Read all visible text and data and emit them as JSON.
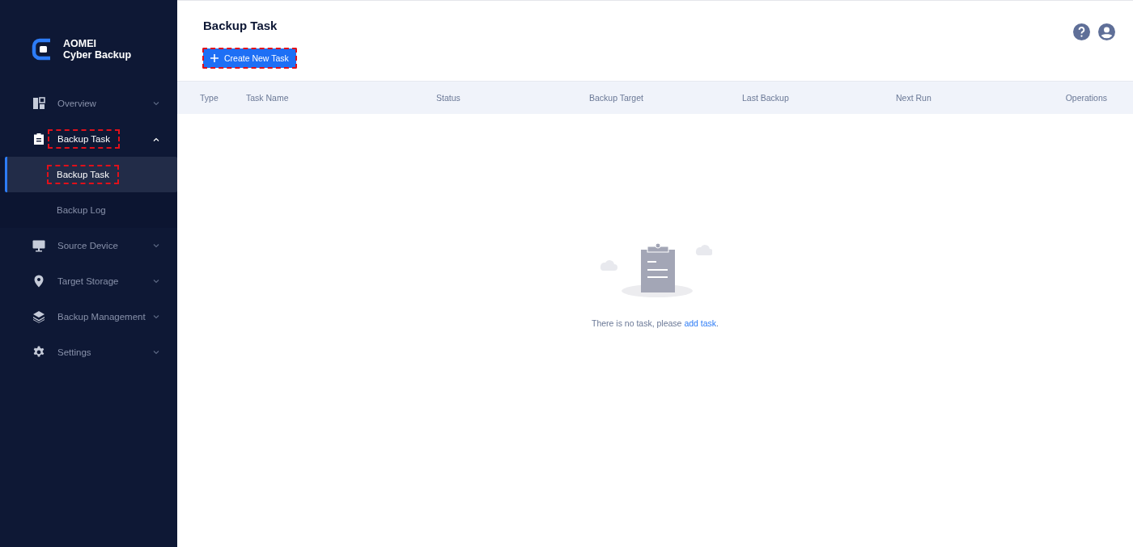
{
  "brand": {
    "line_1": "AOMEI",
    "line_2": "Cyber Backup"
  },
  "sidebar": {
    "items": [
      {
        "label": "Overview",
        "expanded": false,
        "highlighted": false
      },
      {
        "label": "Backup Task",
        "expanded": true,
        "highlighted": true,
        "children": [
          {
            "label": "Backup Task",
            "selected": true,
            "highlighted": true
          },
          {
            "label": "Backup Log",
            "selected": false,
            "highlighted": false
          }
        ]
      },
      {
        "label": "Source Device",
        "expanded": false,
        "highlighted": false
      },
      {
        "label": "Target Storage",
        "expanded": false,
        "highlighted": false
      },
      {
        "label": "Backup Management",
        "expanded": false,
        "highlighted": false
      },
      {
        "label": "Settings",
        "expanded": false,
        "highlighted": false
      }
    ]
  },
  "page": {
    "title": "Backup Task",
    "create_button": {
      "label": "Create New Task",
      "highlighted": true
    }
  },
  "table": {
    "columns": [
      "Type",
      "Task Name",
      "Status",
      "Backup Target",
      "Last Backup",
      "Next Run",
      "Operations"
    ]
  },
  "empty_state": {
    "message": "There is no task, please ",
    "link": "add task",
    "end": "."
  }
}
